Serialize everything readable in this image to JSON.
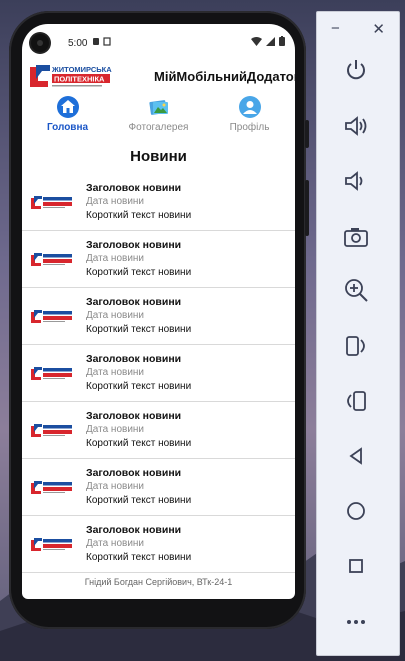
{
  "status_bar": {
    "time": "5:00"
  },
  "app": {
    "title": "МійМобільнийДодаток",
    "logo_text": "ЖИТОМИРСЬКА ПОЛІТЕХНІКА"
  },
  "nav": {
    "items": [
      {
        "label": "Головна",
        "icon": "home-icon",
        "active": true
      },
      {
        "label": "Фотогалерея",
        "icon": "gallery-icon",
        "active": false
      },
      {
        "label": "Профіль",
        "icon": "profile-icon",
        "active": false
      }
    ]
  },
  "section": {
    "title": "Новини"
  },
  "news": [
    {
      "title": "Заголовок новини",
      "date": "Дата новини",
      "text": "Короткий текст новини"
    },
    {
      "title": "Заголовок новини",
      "date": "Дата новини",
      "text": "Короткий текст новини"
    },
    {
      "title": "Заголовок новини",
      "date": "Дата новини",
      "text": "Короткий текст новини"
    },
    {
      "title": "Заголовок новини",
      "date": "Дата новини",
      "text": "Короткий текст новини"
    },
    {
      "title": "Заголовок новини",
      "date": "Дата новини",
      "text": "Короткий текст новини"
    },
    {
      "title": "Заголовок новини",
      "date": "Дата новини",
      "text": "Короткий текст новини"
    },
    {
      "title": "Заголовок новини",
      "date": "Дата новини",
      "text": "Короткий текст новини"
    }
  ],
  "footer": {
    "text": "Гнідий Богдан Сергійович, ВТк-24-1"
  },
  "emulator_panel": {
    "minimize": "−",
    "close": "✕",
    "buttons": [
      "power-icon",
      "volume-up-icon",
      "volume-down-icon",
      "camera-icon",
      "zoom-icon",
      "rotate-left-icon",
      "rotate-right-icon",
      "back-icon",
      "home-circle-icon",
      "overview-icon",
      "more-icon"
    ]
  },
  "colors": {
    "accent": "#1a56c7",
    "nav_inactive": "#8a8a8a",
    "logo_red": "#d8262d",
    "logo_blue": "#1b4ea0"
  }
}
